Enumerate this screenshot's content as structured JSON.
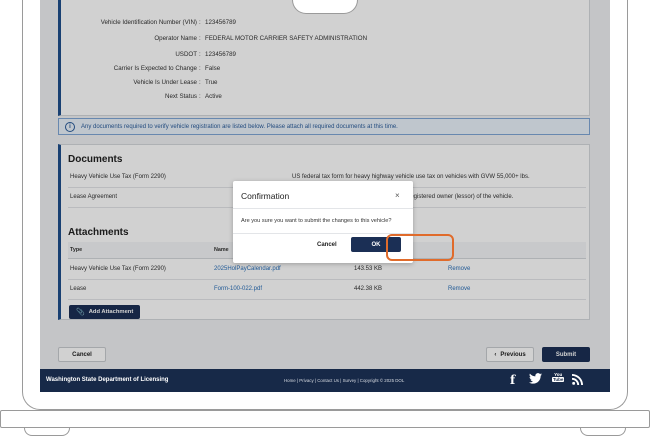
{
  "vehicle": {
    "rows": [
      {
        "label": "Vehicle Identification Number (VIN)",
        "value": "123456789"
      },
      {
        "label": "Operator Name",
        "value": "FEDERAL MOTOR CARRIER SAFETY ADMINISTRATION"
      },
      {
        "label": "USDOT",
        "value": "123456789"
      },
      {
        "label": "Carrier Is Expected to Change",
        "value": "False"
      },
      {
        "label": "Vehicle Is Under Lease",
        "value": "True"
      },
      {
        "label": "Next Status",
        "value": "Active"
      }
    ]
  },
  "info_banner": {
    "icon": "info-icon",
    "text": "Any documents required to verify vehicle registration are listed below. Please attach all required documents at this time."
  },
  "documents": {
    "title": "Documents",
    "items": [
      {
        "name": "Heavy Vehicle Use Tax (Form 2290)",
        "description": "US federal tax form for heavy highway vehicle use tax on vehicles with GVW 55,000+ lbs."
      },
      {
        "name": "Lease Agreement",
        "description": "with the registered owner (lessor) of the vehicle."
      }
    ]
  },
  "attachments": {
    "title": "Attachments",
    "columns": {
      "type": "Type",
      "name": "Name"
    },
    "rows": [
      {
        "type": "Heavy Vehicle Use Tax (Form 2290)",
        "file": "2025HolPayCalendar.pdf",
        "size": "143.53 KB",
        "action": "Remove"
      },
      {
        "type": "Lease",
        "file": "Form-100-022.pdf",
        "size": "442.38 KB",
        "action": "Remove"
      }
    ],
    "add_button": "Add Attachment"
  },
  "actions": {
    "cancel": "Cancel",
    "previous": "Previous",
    "submit": "Submit"
  },
  "footer": {
    "brand": "Washington State Department of Licensing",
    "links": "Home | Privacy | Contact Us | Survey | Copyright © 2025 DOL",
    "social": {
      "facebook": "f",
      "youtube_top": "You",
      "youtube_bottom": "Tube"
    }
  },
  "modal": {
    "title": "Confirmation",
    "close": "×",
    "body": "Are you sure you want to submit the changes to this vehicle?",
    "cancel": "Cancel",
    "ok": "OK"
  },
  "colors": {
    "navy": "#1b2f55",
    "link": "#2a6fb8",
    "highlight": "#e06b2b"
  }
}
